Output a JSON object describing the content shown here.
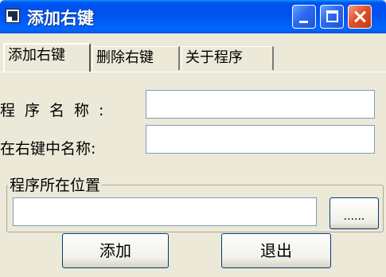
{
  "window": {
    "title": "添加右键",
    "icon": "app-icon",
    "controls": {
      "minimize": "minimize-icon",
      "maximize": "maximize-icon",
      "close": "close-icon"
    }
  },
  "tabs": [
    {
      "label": "添加右键",
      "active": true
    },
    {
      "label": "删除右键",
      "active": false
    },
    {
      "label": "关于程序",
      "active": false
    }
  ],
  "form": {
    "program_name_label": "程序名称:",
    "program_name_value": "",
    "menu_name_label": "在右键中名称:",
    "menu_name_value": "",
    "location_group_label": "程序所在位置",
    "location_value": "",
    "browse_label": "......"
  },
  "buttons": {
    "add_label": "添加",
    "exit_label": "退出"
  }
}
